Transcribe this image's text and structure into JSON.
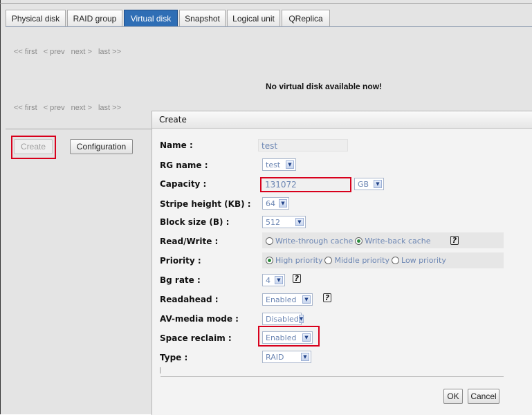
{
  "tabs": [
    {
      "label": "Physical disk",
      "name": "tab-physical-disk",
      "active": false
    },
    {
      "label": "RAID group",
      "name": "tab-raid-group",
      "active": false
    },
    {
      "label": "Virtual disk",
      "name": "tab-virtual-disk",
      "active": true
    },
    {
      "label": "Snapshot",
      "name": "tab-snapshot",
      "active": false
    },
    {
      "label": "Logical unit",
      "name": "tab-logical-unit",
      "active": false
    },
    {
      "label": "QReplica",
      "name": "tab-qreplica",
      "active": false
    }
  ],
  "pager": {
    "first": "<< first",
    "prev": "< prev",
    "next": "next >",
    "last": "last >>"
  },
  "empty_message": "No virtual disk available now!",
  "buttons": {
    "create": "Create",
    "configuration": "Configuration"
  },
  "dialog": {
    "title": "Create",
    "fields": {
      "name": {
        "label": "Name :",
        "value": "test"
      },
      "rg_name": {
        "label": "RG name :",
        "value": "test"
      },
      "capacity": {
        "label": "Capacity :",
        "value": "131072",
        "unit": "GB"
      },
      "stripe_height": {
        "label": "Stripe height (KB) :",
        "value": "64"
      },
      "block_size": {
        "label": "Block size (B) :",
        "value": "512"
      },
      "read_write": {
        "label": "Read/Write :",
        "options": [
          "Write-through cache",
          "Write-back cache"
        ],
        "selected": "Write-back cache"
      },
      "priority": {
        "label": "Priority :",
        "options": [
          "High priority",
          "Middle priority",
          "Low priority"
        ],
        "selected": "High priority"
      },
      "bg_rate": {
        "label": "Bg rate :",
        "value": "4"
      },
      "readahead": {
        "label": "Readahead :",
        "value": "Enabled"
      },
      "av_media_mode": {
        "label": "AV-media mode :",
        "value": "Disabled"
      },
      "space_reclaim": {
        "label": "Space reclaim :",
        "value": "Enabled"
      },
      "type": {
        "label": "Type :",
        "value": "RAID"
      }
    },
    "help_glyph": "?",
    "ok_label": "OK",
    "cancel_label": "Cancel"
  },
  "colors": {
    "highlight_box": "#d8001c",
    "active_tab": "#2f6eb5",
    "value_text": "#6c86b3"
  },
  "icons": {
    "dropdown": "chevron-down-icon",
    "help": "help-icon"
  }
}
